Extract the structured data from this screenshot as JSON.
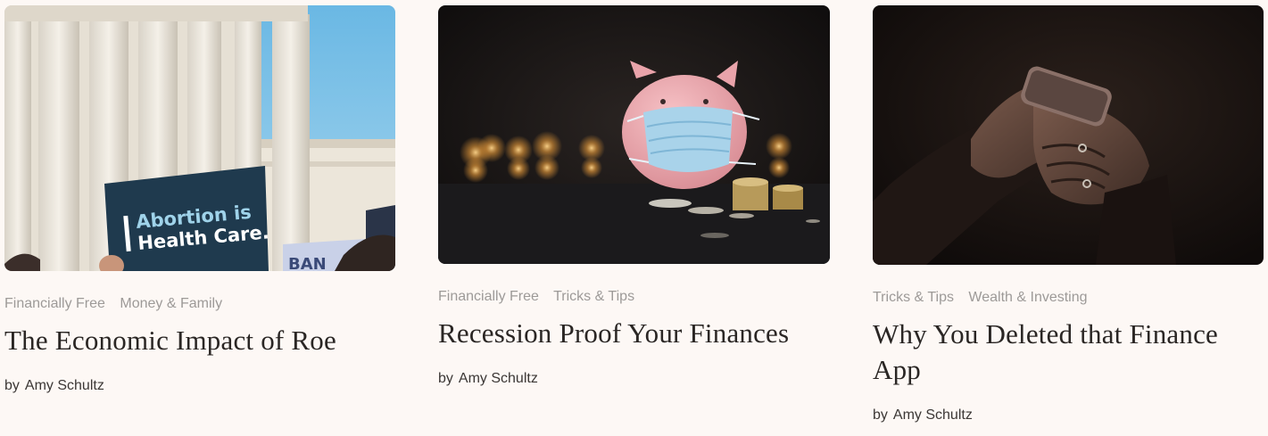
{
  "cards": [
    {
      "image_alt": "Protest signs in front of Supreme Court columns",
      "sign_line1": "Abortion is",
      "sign_line2": "Health Care.",
      "sign2_text": "BAN",
      "tags": [
        "Financially Free",
        "Money & Family"
      ],
      "title": "The Economic Impact of Roe",
      "by": "by",
      "author": "Amy Schultz"
    },
    {
      "image_alt": "Pink piggy bank wearing a face mask next to coins and candles",
      "tags": [
        "Financially Free",
        "Tricks & Tips"
      ],
      "title": "Recession Proof Your Finances",
      "by": "by",
      "author": "Amy Schultz"
    },
    {
      "image_alt": "Hands holding a smartphone in the dark",
      "tags": [
        "Tricks & Tips",
        "Wealth & Investing"
      ],
      "title": "Why You Deleted that Finance App",
      "by": "by",
      "author": "Amy Schultz"
    }
  ],
  "colors": {
    "background": "#fdf8f5",
    "tag": "#9d9a98",
    "title": "#2a2624",
    "byline": "#3b3735"
  }
}
